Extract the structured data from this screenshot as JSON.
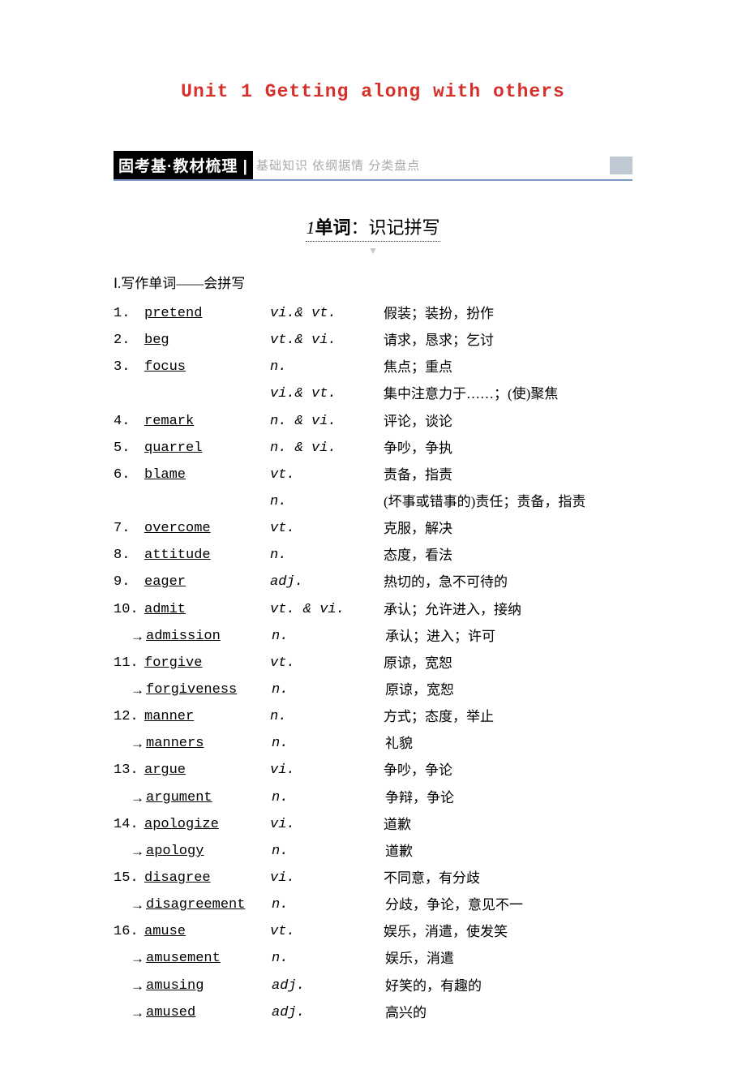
{
  "title": "Unit 1  Getting along with others",
  "sectionBar": {
    "left": "固考基·教材梳理 |",
    "sub": "基础知识 依纲据情 分类盘点"
  },
  "midTitle": {
    "num": "1",
    "bold": "单词",
    "rest": "：识记拼写"
  },
  "subsection": "Ⅰ.写作单词——会拼写",
  "rows": [
    {
      "num": "1.",
      "arrow": false,
      "word": "pretend",
      "pos": "vi.& vt.",
      "def": "假装；装扮，扮作"
    },
    {
      "num": "2.",
      "arrow": false,
      "word": "beg",
      "pos": "vt.& vi.",
      "def": "请求，恳求；乞讨"
    },
    {
      "num": "3.",
      "arrow": false,
      "word": "focus",
      "pos": "n.",
      "def": "焦点；重点"
    },
    {
      "num": "",
      "arrow": false,
      "word": "",
      "pos": "vi.& vt.",
      "def": "集中注意力于……；(使)聚焦"
    },
    {
      "num": "4.",
      "arrow": false,
      "word": "remark",
      "pos": "n. & vi.",
      "def": "评论，谈论"
    },
    {
      "num": "5.",
      "arrow": false,
      "word": "quarrel",
      "pos": "n. & vi.",
      "def": "争吵，争执"
    },
    {
      "num": "6.",
      "arrow": false,
      "word": "blame",
      "pos": "vt.",
      "def": "责备，指责"
    },
    {
      "num": "",
      "arrow": false,
      "word": "",
      "pos": "n.",
      "def": "(坏事或错事的)责任；责备，指责"
    },
    {
      "num": "7.",
      "arrow": false,
      "word": "overcome",
      "pos": "vt.",
      "def": "克服，解决"
    },
    {
      "num": "8.",
      "arrow": false,
      "word": "attitude",
      "pos": "n.",
      "def": "态度，看法"
    },
    {
      "num": "9.",
      "arrow": false,
      "word": "eager",
      "pos": "adj.",
      "def": "热切的，急不可待的"
    },
    {
      "num": "10.",
      "arrow": false,
      "word": "admit",
      "pos": "vt. & vi.",
      "def": "承认；允许进入，接纳"
    },
    {
      "num": "→",
      "arrow": true,
      "word": "admission",
      "pos": "n.",
      "def": "承认；进入；许可"
    },
    {
      "num": "11.",
      "arrow": false,
      "word": "forgive",
      "pos": "vt.",
      "def": "原谅，宽恕"
    },
    {
      "num": "→",
      "arrow": true,
      "word": "forgiveness",
      "pos": "n.",
      "def": "原谅，宽恕"
    },
    {
      "num": "12.",
      "arrow": false,
      "word": "manner",
      "pos": "n.",
      "def": "方式；态度，举止"
    },
    {
      "num": "→",
      "arrow": true,
      "word": "manners",
      "pos": "n.",
      "def": "礼貌"
    },
    {
      "num": "13.",
      "arrow": false,
      "word": "argue",
      "pos": "vi.",
      "def": "争吵，争论"
    },
    {
      "num": "→",
      "arrow": true,
      "word": "argument",
      "pos": "n.",
      "def": "争辩，争论"
    },
    {
      "num": "14.",
      "arrow": false,
      "word": "apologize",
      "pos": "vi.",
      "def": "道歉"
    },
    {
      "num": "→",
      "arrow": true,
      "word": "apology",
      "pos": "n.",
      "def": "道歉"
    },
    {
      "num": "15.",
      "arrow": false,
      "word": "disagree",
      "pos": "vi.",
      "def": "不同意，有分歧"
    },
    {
      "num": "→",
      "arrow": true,
      "word": "disagreement",
      "pos": "n.",
      "def": "分歧，争论，意见不一"
    },
    {
      "num": "16.",
      "arrow": false,
      "word": "amuse",
      "pos": "vt.",
      "def": "娱乐，消遣，使发笑"
    },
    {
      "num": "→",
      "arrow": true,
      "word": "amusement",
      "pos": "n.",
      "def": "娱乐，消遣"
    },
    {
      "num": "→",
      "arrow": true,
      "word": "amusing",
      "pos": "adj.",
      "def": "好笑的，有趣的"
    },
    {
      "num": "→",
      "arrow": true,
      "word": "amused",
      "pos": "adj.",
      "def": "高兴的"
    }
  ]
}
